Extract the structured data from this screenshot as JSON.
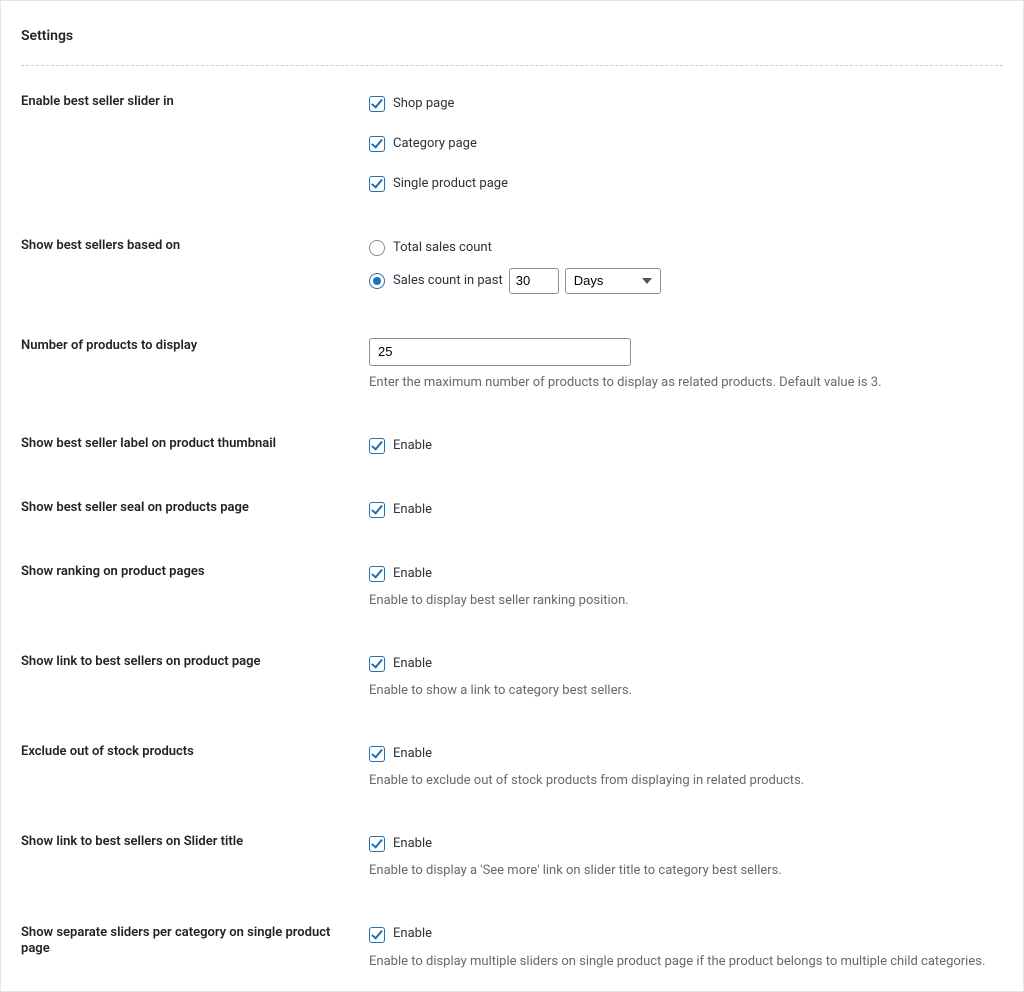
{
  "title": "Settings",
  "labels": {
    "enable_slider_in": "Enable best seller slider in",
    "show_based_on": "Show best sellers based on",
    "num_products": "Number of products to display",
    "show_label_thumb": "Show best seller label on product thumbnail",
    "show_seal_page": "Show best seller seal on products page",
    "show_ranking": "Show ranking on product pages",
    "show_link_product": "Show link to best sellers on product page",
    "exclude_oos": "Exclude out of stock products",
    "show_link_slider_title": "Show link to best sellers on Slider title",
    "separate_sliders": "Show separate sliders per category on single product page"
  },
  "options": {
    "slider_in": {
      "shop": "Shop page",
      "category": "Category page",
      "single": "Single product page"
    },
    "based_on": {
      "total": "Total sales count",
      "past_prefix": "Sales count in past"
    },
    "enable": "Enable"
  },
  "values": {
    "slider_in_shop": true,
    "slider_in_category": true,
    "slider_in_single": true,
    "based_on": "past",
    "past_value": "30",
    "past_unit": "Days",
    "num_products": "25",
    "label_thumb_enable": true,
    "seal_page_enable": true,
    "ranking_enable": true,
    "link_product_enable": true,
    "exclude_oos_enable": true,
    "link_slider_title_enable": true,
    "separate_sliders_enable": true
  },
  "descriptions": {
    "num_products": "Enter the maximum number of products to display as related products. Default value is 3.",
    "ranking": "Enable to display best seller ranking position.",
    "link_product": "Enable to show a link to category best sellers.",
    "exclude_oos": "Enable to exclude out of stock products from displaying in related products.",
    "link_slider_title": "Enable to display a 'See more' link on slider title to category best sellers.",
    "separate_sliders": "Enable to display multiple sliders on single product page if the product belongs to multiple child categories."
  }
}
